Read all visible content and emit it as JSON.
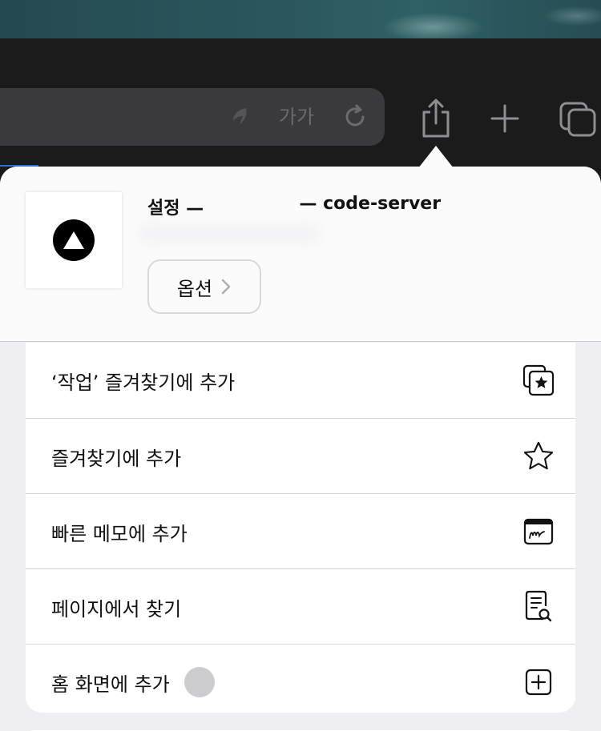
{
  "browser": {
    "reader_text": "가가"
  },
  "share_sheet": {
    "title_prefix": "설정 —",
    "title_suffix": "— code-server",
    "options_label": "옵션",
    "menu": [
      {
        "label": "‘작업’ 즐겨찾기에 추가",
        "icon": "add-to-tab-group-favorites-icon"
      },
      {
        "label": "즐겨찾기에 추가",
        "icon": "star-icon"
      },
      {
        "label": "빠른 메모에 추가",
        "icon": "quick-note-icon"
      },
      {
        "label": "페이지에서 찾기",
        "icon": "find-in-page-icon"
      },
      {
        "label": "홈 화면에 추가",
        "icon": "add-square-icon"
      }
    ]
  },
  "colors": {
    "sheet_background": "#efeff1",
    "toolbar_background": "#1b1b1b",
    "address_bar": "#3a3a3c",
    "accent_line": "#2f6bd8"
  }
}
